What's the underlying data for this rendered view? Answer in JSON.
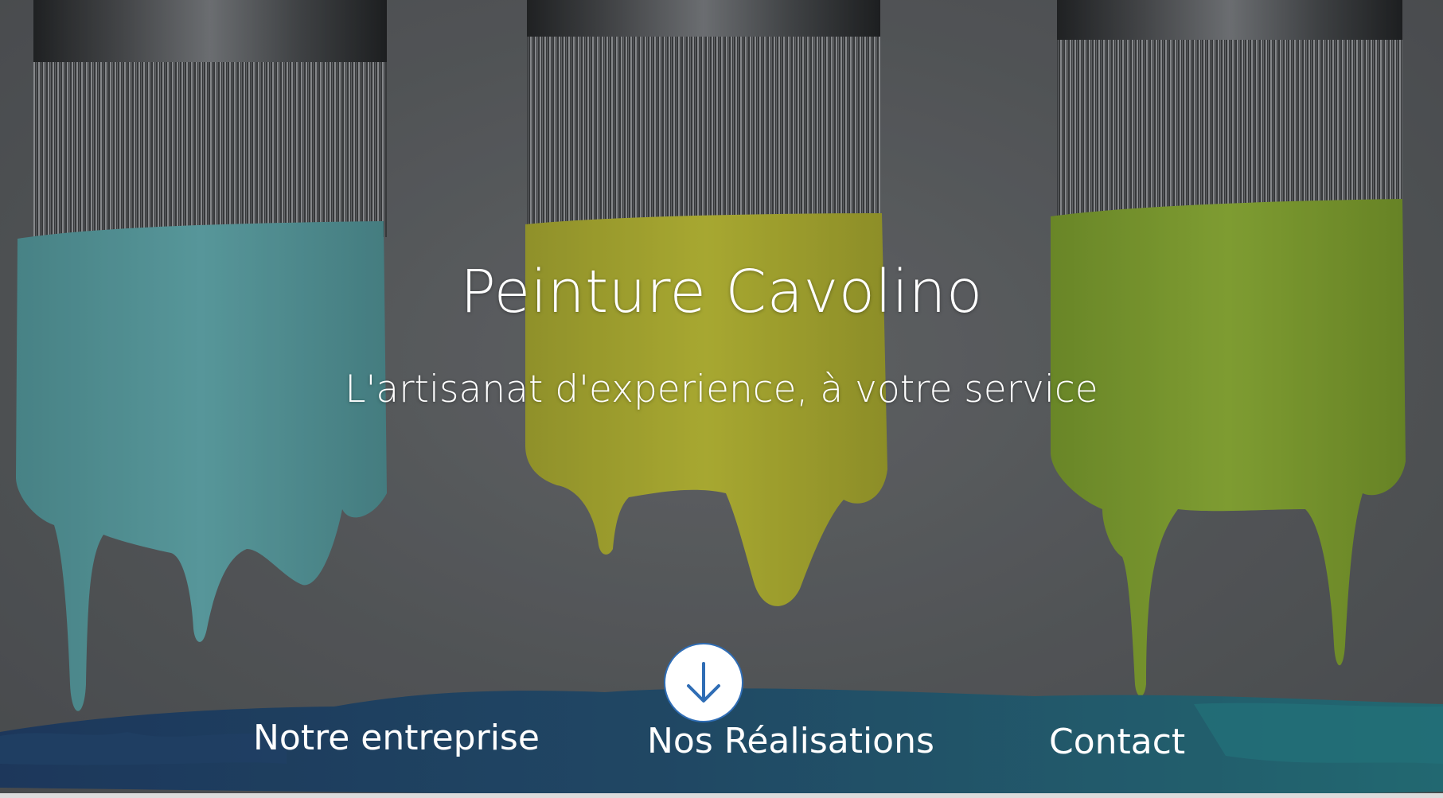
{
  "hero": {
    "title": "Peinture Cavolino",
    "subtitle": "L'artisanat d'experience, à votre service"
  },
  "nav": {
    "items": [
      {
        "label": "Notre entreprise"
      },
      {
        "label": "Nos Réalisations"
      },
      {
        "label": "Contact"
      }
    ],
    "scroll_icon": "arrow-down-icon"
  },
  "colors": {
    "band_left": "#1b3f6b",
    "band_right": "#226f7a",
    "paint_blue": "#5aa3a8",
    "paint_yellow": "#bfbe2e",
    "paint_green": "#8cae2f",
    "accent": "#2f6db5"
  }
}
